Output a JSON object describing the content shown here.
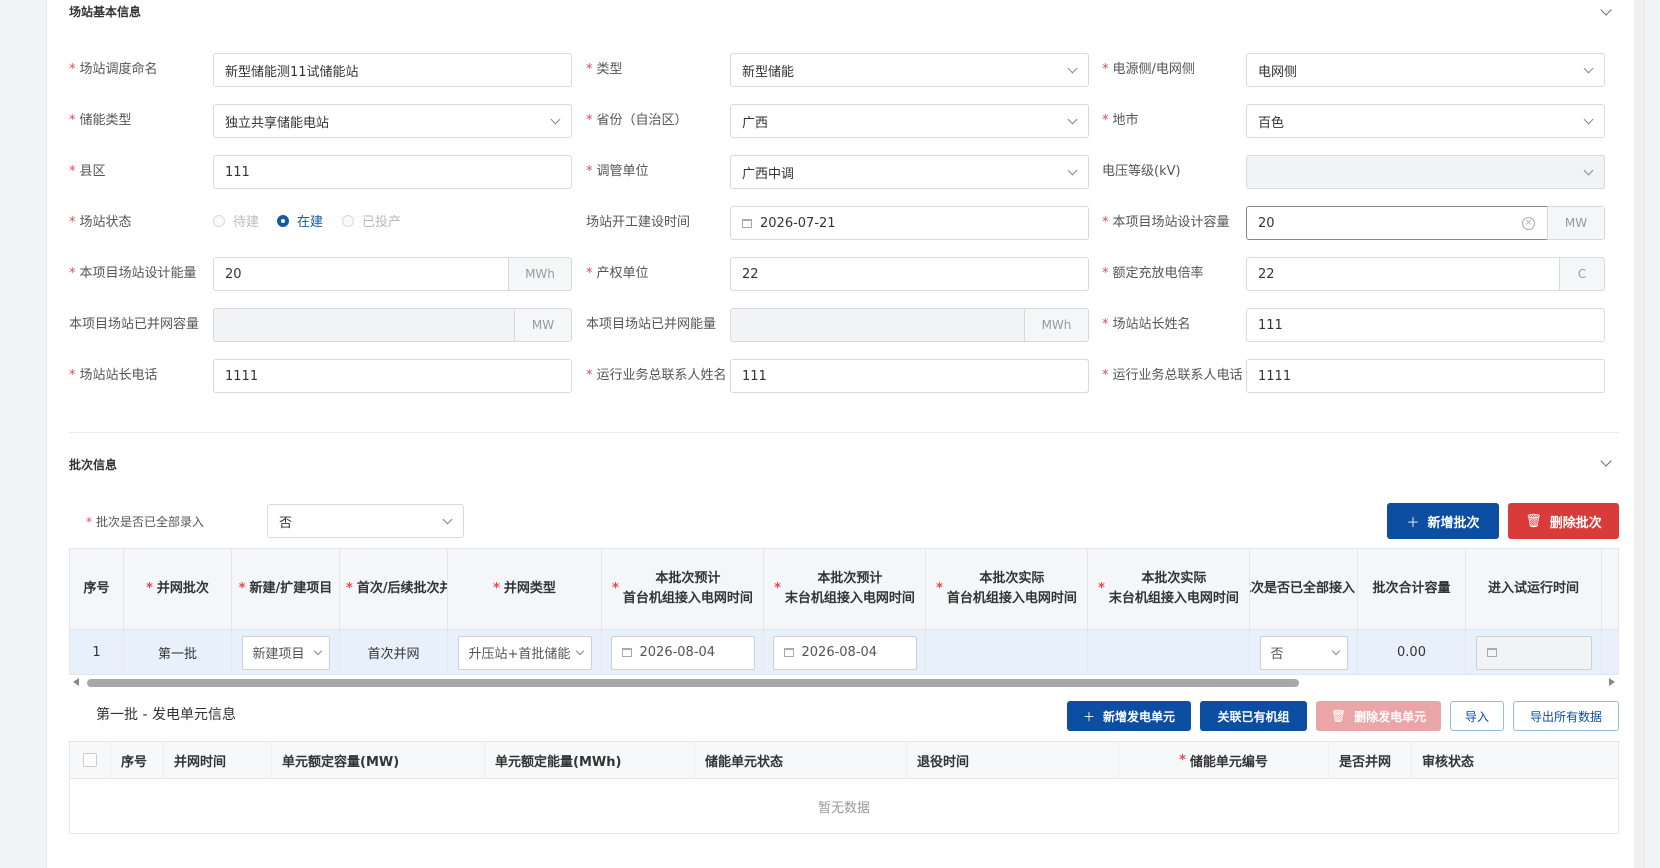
{
  "section_basic": {
    "title": "场站基本信息"
  },
  "form": {
    "station_name": {
      "label": "场站调度命名",
      "value": "新型储能测11试储能站"
    },
    "type": {
      "label": "类型",
      "value": "新型储能"
    },
    "side": {
      "label": "电源侧/电网侧",
      "value": "电网侧"
    },
    "storage_type": {
      "label": "储能类型",
      "value": "独立共享储能电站"
    },
    "province": {
      "label": "省份（自治区）",
      "value": "广西"
    },
    "city": {
      "label": "地市",
      "value": "百色"
    },
    "county": {
      "label": "县区",
      "value": "111"
    },
    "dispatch_unit": {
      "label": "调管单位",
      "value": "广西中调"
    },
    "voltage": {
      "label": "电压等级(kV)",
      "value": ""
    },
    "status": {
      "label": "场站状态",
      "options": [
        "待建",
        "在建",
        "已投产"
      ],
      "selected": "在建"
    },
    "start_time": {
      "label": "场站开工建设时间",
      "value": "2026-07-21"
    },
    "design_capacity": {
      "label": "本项目场站设计容量",
      "value": "20",
      "unit": "MW"
    },
    "design_energy": {
      "label": "本项目场站设计能量",
      "value": "20",
      "unit": "MWh"
    },
    "property_unit": {
      "label": "产权单位",
      "value": "22"
    },
    "charge_rate": {
      "label": "额定充放电倍率",
      "value": "22",
      "unit": "C"
    },
    "grid_capacity": {
      "label": "本项目场站已并网容量",
      "value": "",
      "unit": "MW"
    },
    "grid_energy": {
      "label": "本项目场站已并网能量",
      "value": "",
      "unit": "MWh"
    },
    "manager_name": {
      "label": "场站站长姓名",
      "value": "111"
    },
    "manager_phone": {
      "label": "场站站长电话",
      "value": "1111"
    },
    "ops_contact_name": {
      "label": "运行业务总联系人姓名",
      "value": "111"
    },
    "ops_contact_phone": {
      "label": "运行业务总联系人电话",
      "value": "1111"
    }
  },
  "section_batch": {
    "title": "批次信息"
  },
  "batch_all_entered": {
    "label": "批次是否已全部录入",
    "value": "否"
  },
  "buttons": {
    "add_batch": "新增批次",
    "delete_batch": "删除批次",
    "add_unit": "新增发电单元",
    "link_unit": "关联已有机组",
    "delete_unit": "删除发电单元",
    "import": "导入",
    "export_all": "导出所有数据"
  },
  "batch_table": {
    "headers": {
      "seq": "序号",
      "batch": "并网批次",
      "new_expand": "新建/扩建项目",
      "first_follow": "首次/后续批次并网",
      "grid_type": "并网类型",
      "plan_first_l1": "本批次预计",
      "plan_first_l2": "首台机组接入电网时间",
      "plan_last_l1": "本批次预计",
      "plan_last_l2": "末台机组接入电网时间",
      "act_first_l1": "本批次实际",
      "act_first_l2": "首台机组接入电网时间",
      "act_last_l1": "本批次实际",
      "act_last_l2": "末台机组接入电网时间",
      "all_connected": "批次是否已全部接入",
      "total_capacity": "批次合计容量",
      "trial_time": "进入试运行时间"
    },
    "row": {
      "seq": "1",
      "batch": "第一批",
      "new_expand": "新建项目",
      "first_follow": "首次并网",
      "grid_type": "升压站+首批储能",
      "plan_first": "2026-08-04",
      "plan_last": "2026-08-04",
      "act_first": "",
      "act_last": "",
      "all_connected": "否",
      "total_capacity": "0.00",
      "trial_time": ""
    }
  },
  "unit_section": {
    "title": "第一批 - 发电单元信息"
  },
  "unit_table": {
    "headers": [
      "序号",
      "并网时间",
      "单元额定容量(MW)",
      "单元额定能量(MWh)",
      "储能单元状态",
      "退役时间",
      "储能单元编号",
      "是否并网",
      "审核状态"
    ],
    "empty_text": "暂无数据"
  },
  "colors": {
    "primary": "#0b4ea2",
    "danger": "#d93a3a",
    "required": "#e5484d"
  }
}
